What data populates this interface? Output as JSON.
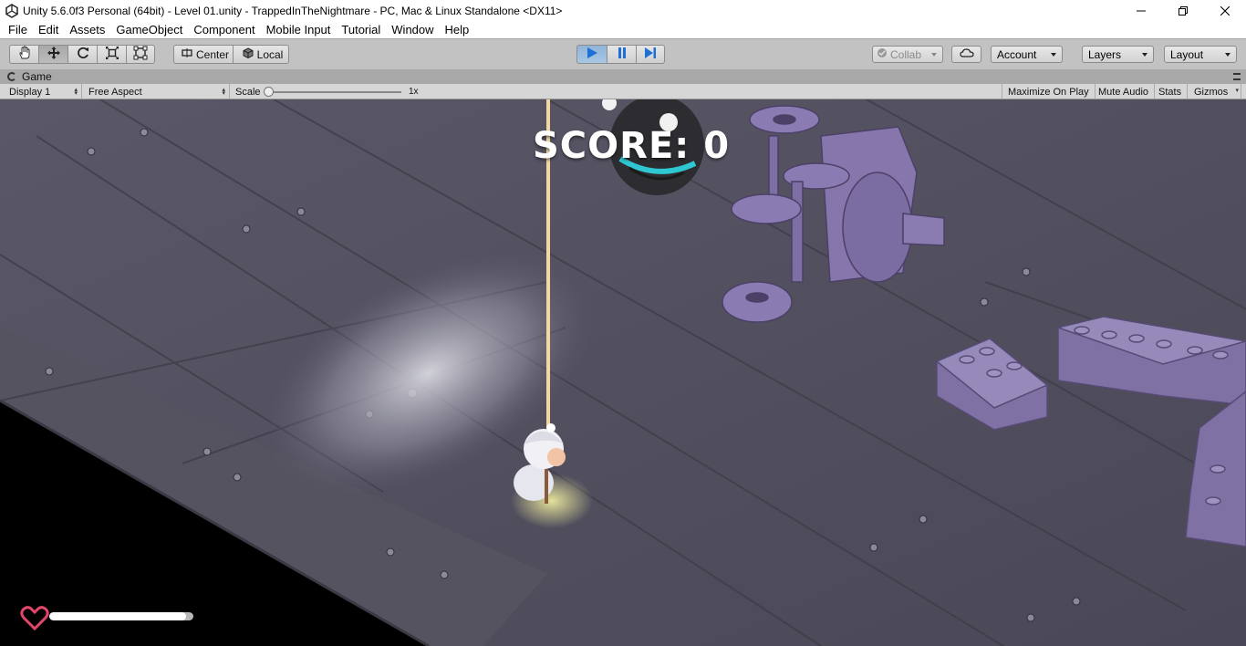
{
  "window": {
    "title": "Unity 5.6.0f3 Personal (64bit) - Level 01.unity - TrappedInTheNightmare - PC, Mac & Linux Standalone <DX11>"
  },
  "menu": [
    "File",
    "Edit",
    "Assets",
    "GameObject",
    "Component",
    "Mobile Input",
    "Tutorial",
    "Window",
    "Help"
  ],
  "toolbar": {
    "tools": [
      "hand-tool-icon",
      "move-tool-icon",
      "rotate-tool-icon",
      "scale-tool-icon",
      "rect-tool-icon"
    ],
    "active_tool": "move",
    "pivot_label": "Center",
    "space_label": "Local",
    "play_state": "playing",
    "collab_label": "Collab",
    "account_label": "Account",
    "layers_label": "Layers",
    "layout_label": "Layout"
  },
  "game_tab": {
    "label": "Game",
    "display": "Display 1",
    "aspect": "Free Aspect",
    "scale_label": "Scale",
    "scale_value": "1x",
    "maximize": "Maximize On Play",
    "mute": "Mute Audio",
    "stats": "Stats",
    "gizmos": "Gizmos"
  },
  "hud": {
    "score_text": "SCORE: 0",
    "health_fraction": 0.95,
    "heart_color": "#e2476b"
  }
}
